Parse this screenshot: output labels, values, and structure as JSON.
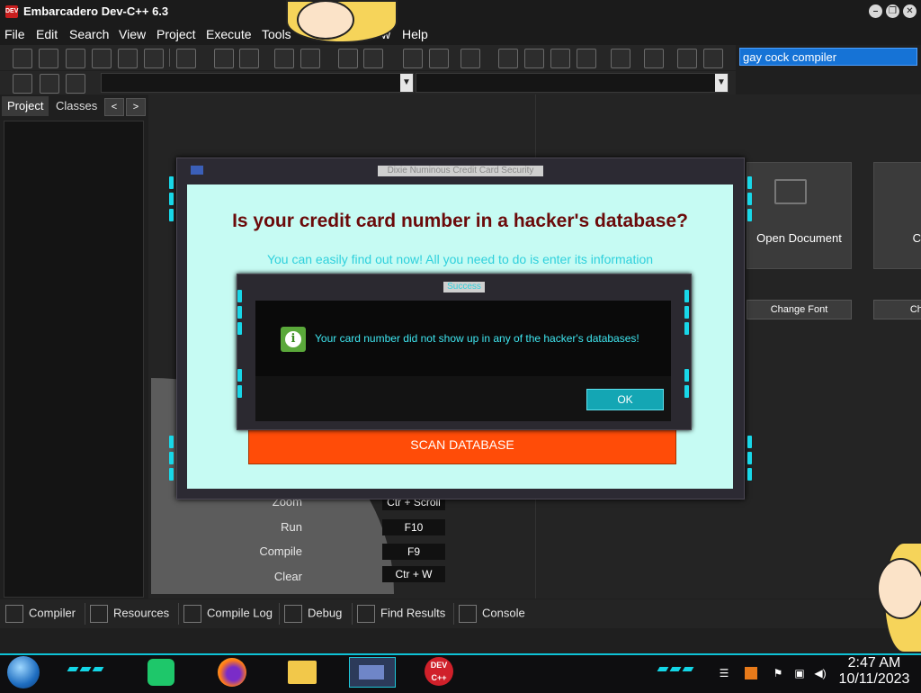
{
  "window": {
    "title": "Embarcadero Dev-C++ 6.3",
    "app_icon_text": "DEV",
    "controls": [
      "–",
      "❐",
      "✕"
    ]
  },
  "menu": [
    "File",
    "Edit",
    "Search",
    "View",
    "Project",
    "Execute",
    "Tools",
    "",
    "w",
    "Help"
  ],
  "search": {
    "value": "gay cock compiler"
  },
  "panel": {
    "tabs": [
      "Project",
      "Classes"
    ],
    "prev": "<",
    "next": ">"
  },
  "start_page": {
    "cards": [
      {
        "label": "Open Document"
      },
      {
        "label": "C"
      }
    ],
    "buttons": [
      "Change Font",
      "Cha"
    ],
    "shortcuts": [
      {
        "action": "Zoom",
        "keys": "Ctr + Scroll"
      },
      {
        "action": "Run",
        "keys": "F10"
      },
      {
        "action": "Compile",
        "keys": "F9"
      },
      {
        "action": "Clear",
        "keys": "Ctr + W"
      }
    ]
  },
  "bottom_tabs": [
    "Compiler",
    "Resources",
    "Compile Log",
    "Debug",
    "Find Results",
    "Console"
  ],
  "main_dialog": {
    "title": "Dixie Numinous Credit Card Security",
    "heading": "Is your credit card number in a hacker's database?",
    "subtitle": "You can easily find out now! All you need to do is enter its information",
    "scan_button": "SCAN DATABASE"
  },
  "success_dialog": {
    "title": "Success",
    "message": "Your card number did not show up in any of the hacker's databases!",
    "ok_button": "OK",
    "icon": "information-icon"
  },
  "taskbar": {
    "apps": [
      "notes-icon",
      "firefox-icon",
      "file-explorer-icon",
      "app-window-icon",
      "devcpp-icon"
    ],
    "devcpp_label": "DEV C++",
    "time": "2:47 AM",
    "date": "10/11/2023"
  },
  "colors": {
    "accent_cyan": "#18d7e8",
    "scan_orange": "#ff4c08",
    "dialog_bg": "#c6fbf3",
    "heading_red": "#6b0a0a",
    "search_blue": "#1673d6"
  }
}
